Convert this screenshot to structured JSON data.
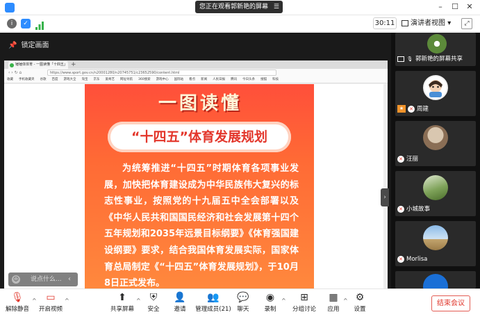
{
  "titlebar": {
    "sharing_banner": "您正在观看郭新艳的屏幕",
    "banner_menu_icon": "menu-icon"
  },
  "infobar": {
    "timer": "30:11",
    "view_button": "演讲者视图",
    "view_caret": "▾"
  },
  "share": {
    "lock_screen": "锁定画面",
    "side_toggle": "›"
  },
  "browser": {
    "tab_title": "锤锤体体育 - 一图读懂「十四五」",
    "new_tab": "+",
    "url": "https://www.sport.gov.cn/n20001280/n20745751/c23652590/content.html",
    "bookmarks": [
      "收藏",
      "手机收藏夹",
      "谷歌",
      "百度",
      "游戏大全",
      "淘宝",
      "京东",
      "爱奇艺",
      "网址导航",
      "360搜索",
      "游戏中心",
      "国际站",
      "看点",
      "新闻",
      "人民日报",
      "腾讯",
      "今日头条",
      "搜狐",
      "科技"
    ]
  },
  "poster": {
    "title": "一图读懂",
    "subtitle": "“十四五”体育发展规划",
    "body": "为统筹推进“十四五”时期体育各项事业发展，加快把体育建设成为中华民族伟大复兴的标志性事业，按照党的十九届五中全会部署以及《中华人民共和国国民经济和社会发展第十四个五年规划和2035年远景目标纲要》《体育强国建设纲要》要求，结合我国体育发展实际，国家体育总局制定《“十四五”体育发展规划》，于10月8日正式发布。"
  },
  "chat": {
    "placeholder": "说点什么...",
    "collapse": "‹"
  },
  "gallery": {
    "participants": [
      {
        "name": "郭新艳的屏幕共享",
        "role": "presenter"
      },
      {
        "name": "周建",
        "role": "host"
      },
      {
        "name": "汪丽",
        "role": "attendee"
      },
      {
        "name": "小城故事",
        "role": "attendee"
      },
      {
        "name": "Morlisa",
        "role": "attendee"
      },
      {
        "name": "",
        "role": "attendee"
      }
    ]
  },
  "toolbar": {
    "unmute": "解除静音",
    "start_video": "开启视频",
    "share_screen": "共享屏幕",
    "security": "安全",
    "invite": "邀请",
    "participants": "管理成员(21)",
    "chat": "聊天",
    "record": "录制",
    "breakout": "分组讨论",
    "apps": "应用",
    "settings": "设置",
    "end_meeting": "结束会议"
  },
  "colors": {
    "poster_red": "#ff4f3a",
    "poster_orange": "#ff8b3e",
    "end_red": "#e0362b",
    "gallery_bg": "#101010"
  }
}
